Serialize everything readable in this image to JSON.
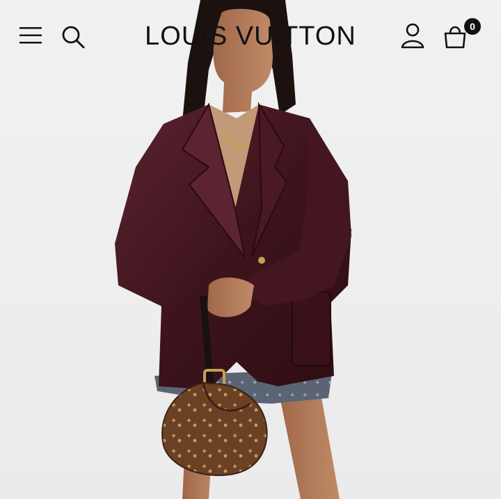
{
  "header": {
    "brand": "LOUIS VUITTON",
    "cart_count": "0",
    "icons": [
      "menu-icon",
      "search-icon",
      "account-icon",
      "shopping-bag-icon"
    ]
  },
  "hero": {
    "image": "model-in-burgundy-leather-blazer-with-monogram-bag"
  },
  "colors": {
    "background": "#eeeeee",
    "jacket": "#4a1a22",
    "monogram": "#5a3a24",
    "text": "#111111"
  }
}
